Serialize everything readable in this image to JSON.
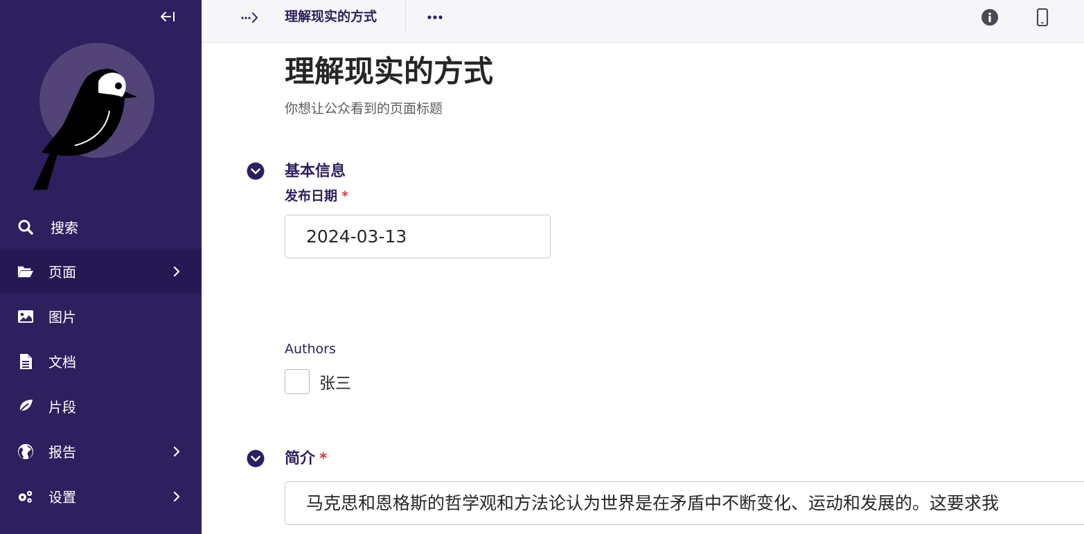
{
  "sidebar": {
    "collapse_label": "←I",
    "items": [
      {
        "label": "搜索",
        "icon": "search-icon"
      },
      {
        "label": "页面",
        "icon": "folder-open-icon",
        "has_submenu": true,
        "active": true
      },
      {
        "label": "图片",
        "icon": "image-icon"
      },
      {
        "label": "文档",
        "icon": "document-icon"
      },
      {
        "label": "片段",
        "icon": "leaf-icon"
      },
      {
        "label": "报告",
        "icon": "globe-icon",
        "has_submenu": true
      },
      {
        "label": "设置",
        "icon": "cogs-icon",
        "has_submenu": true
      }
    ]
  },
  "header": {
    "breadcrumb_title": "理解现实的方式"
  },
  "page": {
    "title": "理解现实的方式",
    "subtitle": "你想让公众看到的页面标题"
  },
  "sections": {
    "basic_info": {
      "heading": "基本信息",
      "publish_date_label": "发布日期",
      "publish_date_value": "2024-03-13",
      "required_mark": "*"
    },
    "authors": {
      "label": "Authors",
      "options": [
        {
          "label": "张三",
          "checked": false
        }
      ]
    },
    "intro": {
      "heading": "简介",
      "required_mark": "*",
      "value": "马克思和恩格斯的哲学观和方法论认为世界是在矛盾中不断变化、运动和发展的。这要求我"
    }
  },
  "colors": {
    "sidebar_bg": "#2e1f5e",
    "sidebar_active_bg": "#261953",
    "accent": "#2e1f5e",
    "required": "#cd4444"
  }
}
